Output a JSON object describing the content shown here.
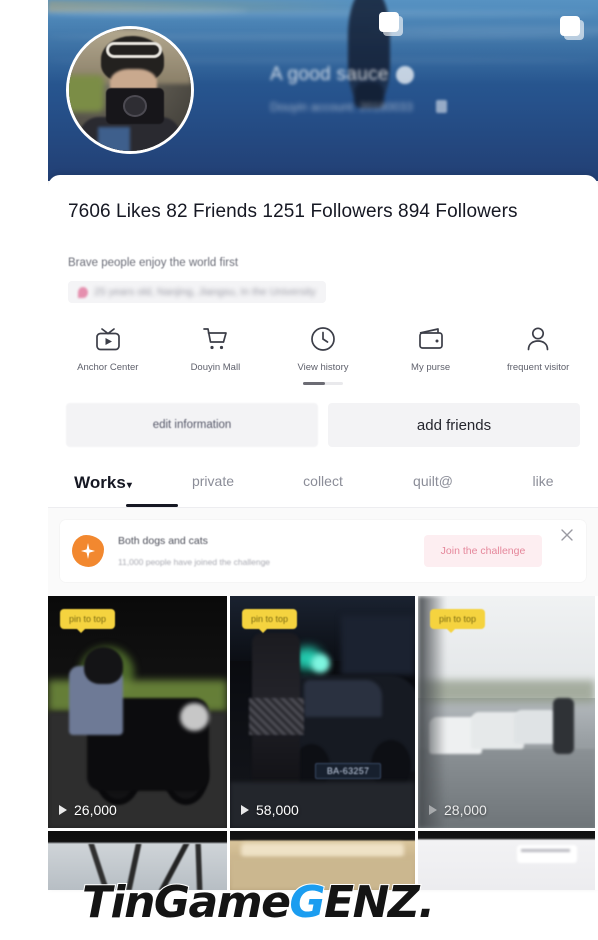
{
  "profile": {
    "cover_username": "A good sauce",
    "cover_subtitle": "Douyin account: 20180033",
    "stats_line": "7606 Likes 82 Friends 1251 Followers 894 Followers",
    "bio": "Brave people enjoy the world first",
    "tag_text": "25 years old, Nanjing, Jiangsu, In the University"
  },
  "quick_actions": [
    {
      "icon": "anchor-center-icon",
      "label": "Anchor Center"
    },
    {
      "icon": "shopping-cart-icon",
      "label": "Douyin Mall"
    },
    {
      "icon": "clock-icon",
      "label": "View history"
    },
    {
      "icon": "wallet-icon",
      "label": "My purse"
    },
    {
      "icon": "person-icon",
      "label": "frequent visitor"
    }
  ],
  "buttons": {
    "edit_label": "edit information",
    "add_friends_label": "add friends"
  },
  "tabs": [
    {
      "label": "Works",
      "caret": "▾",
      "active": true
    },
    {
      "label": "private",
      "caret": "",
      "active": false
    },
    {
      "label": "collect",
      "caret": "",
      "active": false
    },
    {
      "label": "quilt@",
      "caret": "",
      "active": false
    },
    {
      "label": "like",
      "caret": "",
      "active": false
    }
  ],
  "banner": {
    "icon": "sparkle-flower-icon",
    "title": "Both dogs and cats",
    "subtitle": "11,000 people have joined the challenge",
    "join_label": "Join the challenge",
    "close_icon": "close-icon",
    "accent_color": "#f2882f",
    "join_bg": "#fdeef1",
    "join_text_color": "#e5879b"
  },
  "videos": [
    {
      "pin_label": "pin to top",
      "views": "26,000",
      "has_multiselect": false
    },
    {
      "pin_label": "pin to top",
      "views": "58,000",
      "has_multiselect": true
    },
    {
      "pin_label": "pin to top",
      "views": "28,000",
      "has_multiselect": false
    }
  ],
  "video_detail": {
    "license_plate": "BA-63257"
  },
  "row2": [
    {
      "has_multiselect": false
    },
    {
      "has_multiselect": false
    },
    {
      "has_multiselect": true
    }
  ],
  "watermark": {
    "part1": "TinGame",
    "part2": "G",
    "part3": "ENZ.",
    "accent_color": "#1b9df0"
  }
}
